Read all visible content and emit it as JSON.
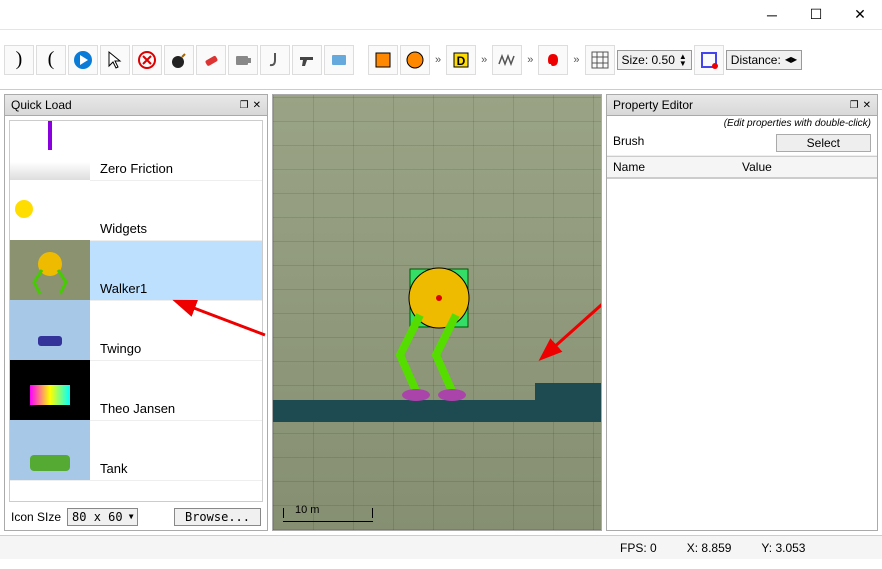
{
  "window": {
    "title": ""
  },
  "toolbar": {
    "size_label": "Size: 0.50",
    "distance_label": "Distance:"
  },
  "quick_load": {
    "title": "Quick Load",
    "items": [
      {
        "label": "Zero Friction"
      },
      {
        "label": "Widgets"
      },
      {
        "label": "Walker1",
        "selected": true
      },
      {
        "label": "Twingo"
      },
      {
        "label": "Theo Jansen"
      },
      {
        "label": "Tank"
      }
    ],
    "icon_size_label": "Icon SIze",
    "icon_size_value": "80 x 60",
    "browse_label": "Browse..."
  },
  "canvas": {
    "scale_label": "10 m"
  },
  "property_editor": {
    "title": "Property Editor",
    "hint": "(Edit properties with double-click)",
    "brush_label": "Brush",
    "select_label": "Select",
    "col_name": "Name",
    "col_value": "Value"
  },
  "status": {
    "fps_label": "FPS:",
    "fps_value": "0",
    "x_label": "X:",
    "x_value": "8.859",
    "y_label": "Y:",
    "y_value": "3.053"
  }
}
